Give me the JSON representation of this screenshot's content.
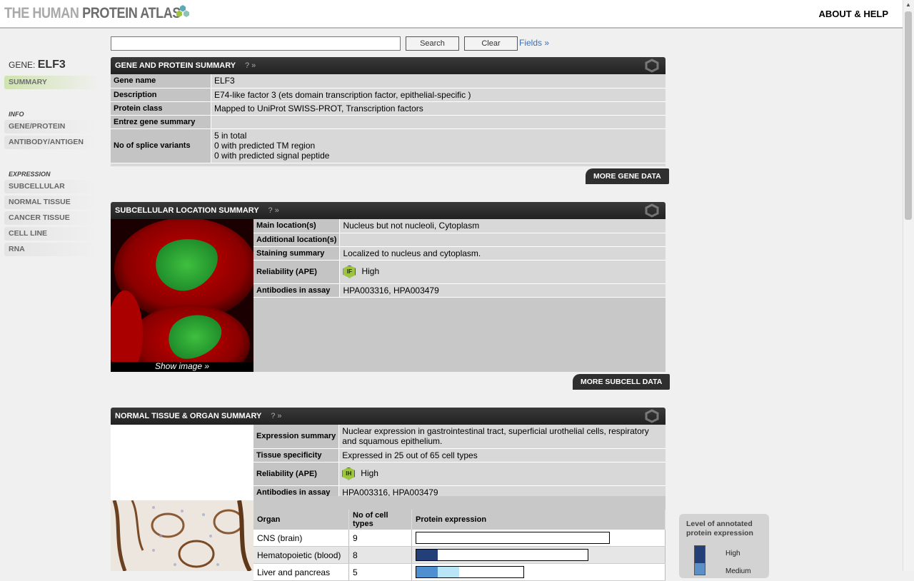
{
  "header": {
    "logo_prefix": "THE HUMAN",
    "logo_main": "PROTEIN ATLAS",
    "about": "ABOUT & HELP"
  },
  "search": {
    "value": "",
    "search_label": "Search",
    "clear_label": "Clear",
    "fields_label": "Fields »"
  },
  "sidebar": {
    "gene_prefix": "GENE:",
    "gene_name": "ELF3",
    "summary": "SUMMARY",
    "info_head": "INFO",
    "info_items": [
      "GENE/PROTEIN",
      "ANTIBODY/ANTIGEN"
    ],
    "expr_head": "EXPRESSION",
    "expr_items": [
      "SUBCELLULAR LOCATION",
      "NORMAL TISSUE",
      "CANCER TISSUE",
      "CELL LINE",
      "RNA"
    ]
  },
  "gene_summary": {
    "title": "GENE AND PROTEIN SUMMARY",
    "help": "? »",
    "rows": [
      {
        "label": "Gene name",
        "value": "ELF3"
      },
      {
        "label": "Description",
        "value": "E74-like factor 3 (ets domain transcription factor, epithelial-specific )"
      },
      {
        "label": "Protein class",
        "value": "Mapped to UniProt SWISS-PROT, Transcription factors"
      },
      {
        "label": "Entrez gene summary",
        "value": ""
      }
    ],
    "splice_label": "No of splice variants",
    "splice_lines": [
      "5 in total",
      "0 with predicted TM region",
      "0 with predicted signal peptide"
    ],
    "more": "MORE GENE DATA"
  },
  "subcell": {
    "title": "SUBCELLULAR LOCATION SUMMARY",
    "help": "? »",
    "main_label": "Main location(s)",
    "main_value": "Nucleus but not nucleoli, Cytoplasm",
    "add_label": "Additional location(s)",
    "add_value": "",
    "stain_label": "Staining summary",
    "stain_value": "Localized to nucleus and cytoplasm.",
    "rel_label": "Reliability (APE)",
    "rel_badge": "IF",
    "rel_value": "High",
    "ab_label": "Antibodies in assay",
    "ab_value": "HPA003316, HPA003479",
    "show_image": "Show image »",
    "more": "MORE SUBCELL DATA"
  },
  "tissue": {
    "title": "NORMAL TISSUE & ORGAN SUMMARY",
    "help": "? »",
    "expr_label": "Expression summary",
    "expr_value": "Nuclear expression in gastrointestinal tract, superficial urothelial cells, respiratory and squamous epithelium.",
    "spec_label": "Tissue specificity",
    "spec_value": "Expressed in 25 out of 65 cell types",
    "rel_label": "Reliability (APE)",
    "rel_badge": "IH",
    "rel_value": "High",
    "ab_label": "Antibodies in assay",
    "ab_value": "HPA003316, HPA003479",
    "table_headers": [
      "Organ",
      "No of cell types",
      "Protein expression"
    ],
    "organs": [
      {
        "name": "CNS (brain)",
        "count": "9",
        "high": 0,
        "medium": 0
      },
      {
        "name": "Hematopoietic (blood)",
        "count": "8",
        "high": 1,
        "medium": 0
      },
      {
        "name": "Liver and pancreas",
        "count": "5",
        "high": 0,
        "medium": 1
      }
    ]
  },
  "legend": {
    "title": "Level of annotated protein expression",
    "high": "High",
    "medium": "Medium"
  },
  "colors": {
    "high": "#223f78",
    "medium": "#4d8fcf",
    "low": "#b9e6f7",
    "accent": "#3a6eb4"
  }
}
